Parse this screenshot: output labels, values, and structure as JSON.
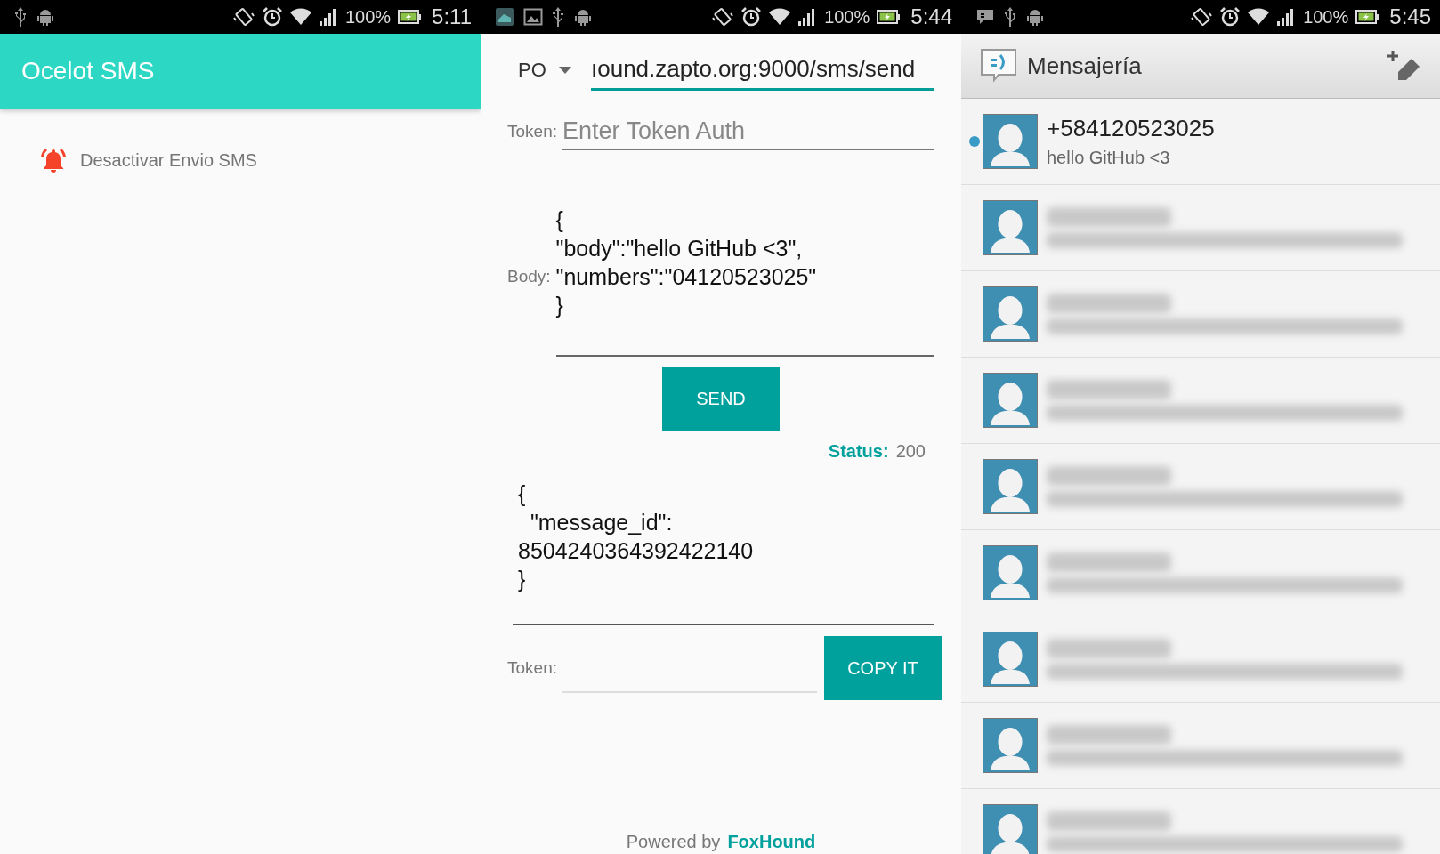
{
  "status_bars": [
    {
      "left_icons": [
        {
          "kind": "usb"
        },
        {
          "kind": "android"
        }
      ],
      "battery": "100%",
      "time": "5:11"
    },
    {
      "left_icons": [
        {
          "kind": "app"
        },
        {
          "kind": "image"
        },
        {
          "kind": "usb"
        },
        {
          "kind": "android"
        }
      ],
      "battery": "100%",
      "time": "5:44"
    },
    {
      "left_icons": [
        {
          "kind": "message"
        },
        {
          "kind": "usb"
        },
        {
          "kind": "android"
        }
      ],
      "battery": "100%",
      "time": "5:45"
    }
  ],
  "ocelot": {
    "title": "Ocelot SMS",
    "menu": [
      {
        "label": "Desactivar Envio SMS"
      }
    ]
  },
  "sender": {
    "method": "PO",
    "url": "ıound.zapto.org:9000/sms/send",
    "token_label": "Token:",
    "token_placeholder": "Enter Token Auth",
    "body_label": "Body:",
    "body": [
      "{",
      "\"body\":\"hello GitHub <3\",",
      "\"numbers\":\"04120523025\"",
      "}"
    ],
    "send": "SEND",
    "status_label": "Status:",
    "status": "200",
    "response": [
      "{",
      "  \"message_id\":",
      "8504240364392422140",
      "}"
    ],
    "token2_label": "Token:",
    "copy": "COPY IT",
    "footer": "Powered by",
    "footer_link": "FoxHound"
  },
  "messaging": {
    "title": "Mensajería",
    "conversations": [
      {
        "kind": "message",
        "name": "+584120523025",
        "preview": "hello GitHub <3",
        "unread": true
      },
      {
        "kind": "blurred",
        "unread": false
      },
      {
        "kind": "blurred",
        "unread": false
      },
      {
        "kind": "blurred",
        "unread": false
      },
      {
        "kind": "blurred",
        "unread": false
      },
      {
        "kind": "blurred",
        "unread": false
      },
      {
        "kind": "blurred",
        "unread": false
      },
      {
        "kind": "blurred",
        "unread": false
      },
      {
        "kind": "blurred",
        "unread": false
      }
    ]
  }
}
